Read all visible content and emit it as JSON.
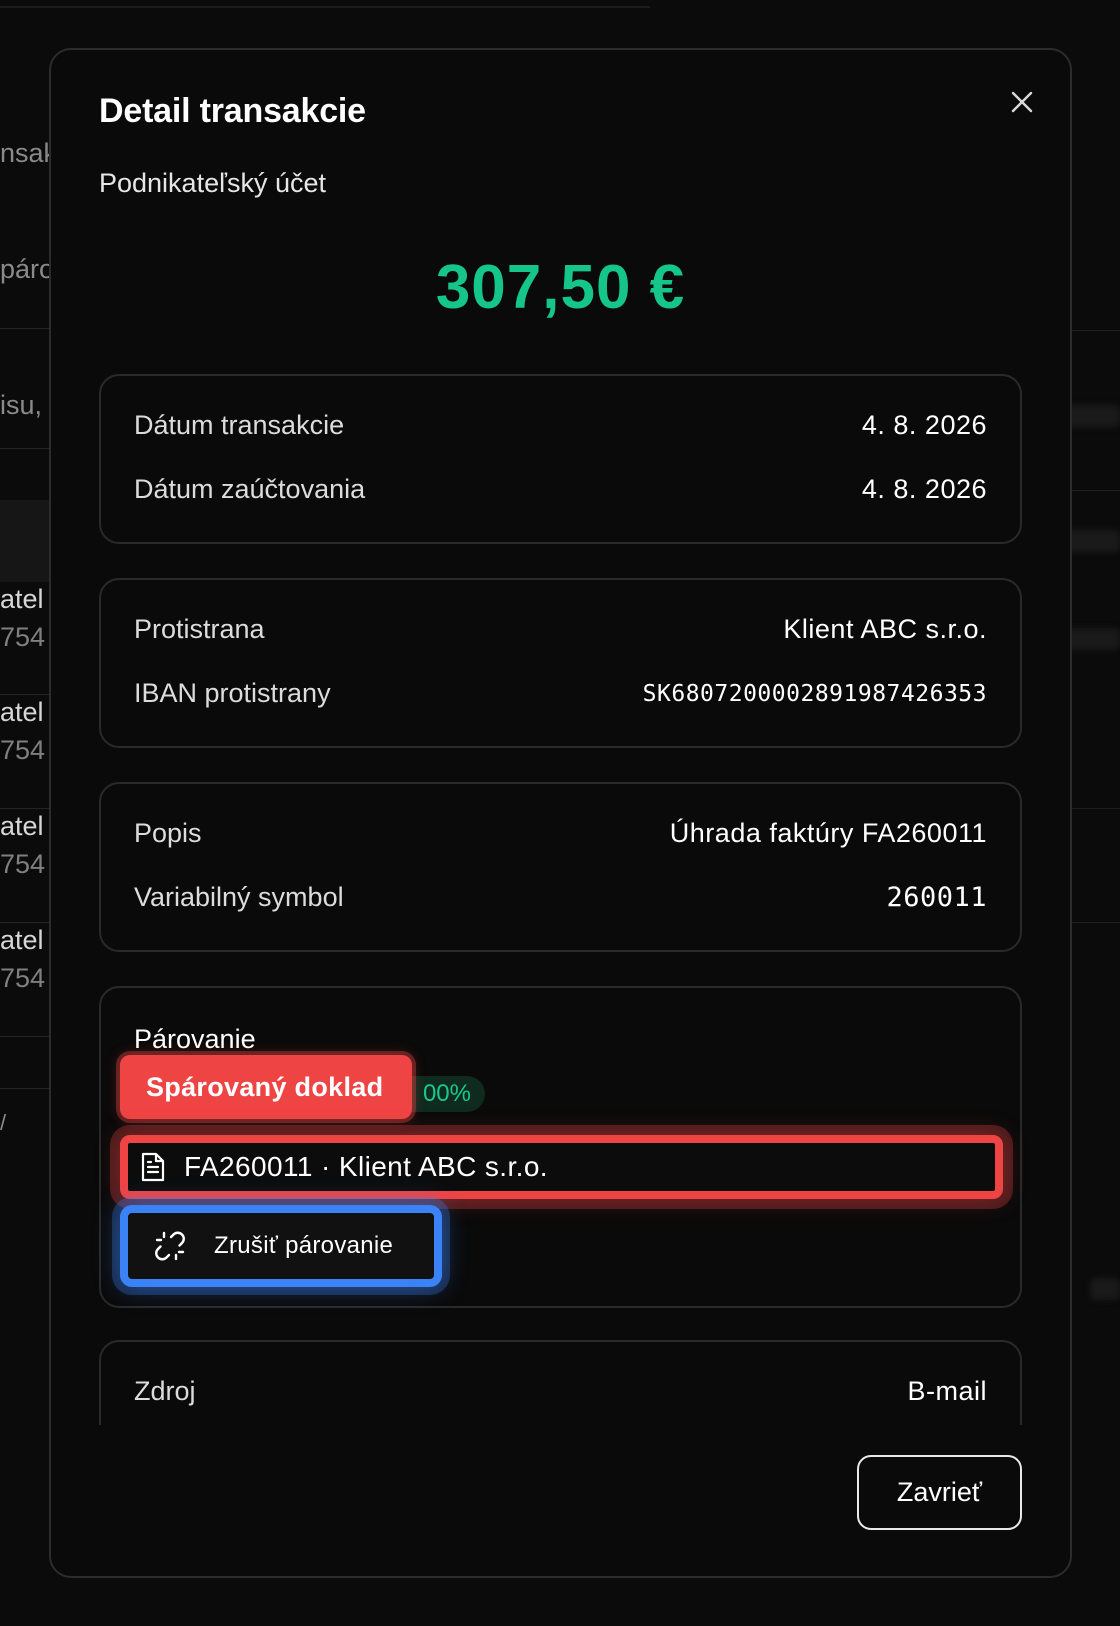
{
  "background": {
    "fragments": [
      "nsak",
      "páro",
      "isu,"
    ],
    "rows": [
      {
        "name": "atel",
        "num": "754"
      },
      {
        "name": "atel",
        "num": "754"
      },
      {
        "name": "atel",
        "num": "754"
      },
      {
        "name": "atel",
        "num": "754"
      }
    ],
    "stray": "/"
  },
  "modal": {
    "title": "Detail transakcie",
    "subtitle": "Podnikateľský účet",
    "amount": "307,50 €",
    "close_icon": "close-icon",
    "dates": {
      "transaction_label": "Dátum transakcie",
      "transaction_value": "4. 8. 2026",
      "posting_label": "Dátum zaúčtovania",
      "posting_value": "4. 8. 2026"
    },
    "counterparty": {
      "label": "Protistrana",
      "value": "Klient ABC s.r.o.",
      "iban_label": "IBAN protistrany",
      "iban_value": "SK6807200002891987426353"
    },
    "description": {
      "label": "Popis",
      "value": "Úhrada faktúry FA260011",
      "vs_label": "Variabilný symbol",
      "vs_value": "260011"
    },
    "pairing": {
      "title": "Párovanie",
      "matched_tag": "Spárovaný doklad",
      "match_percent": "00%",
      "document_icon": "document-icon",
      "document": "FA260011 · Klient ABC s.r.o.",
      "unpair_icon": "unlink-icon",
      "unpair_label": "Zrušiť párovanie"
    },
    "source": {
      "label": "Zdroj",
      "value": "B-mail"
    },
    "close_button": "Zavrieť"
  },
  "colors": {
    "amount": "#15c589",
    "highlight_red": "#ef4444",
    "highlight_blue": "#3b82f6"
  }
}
